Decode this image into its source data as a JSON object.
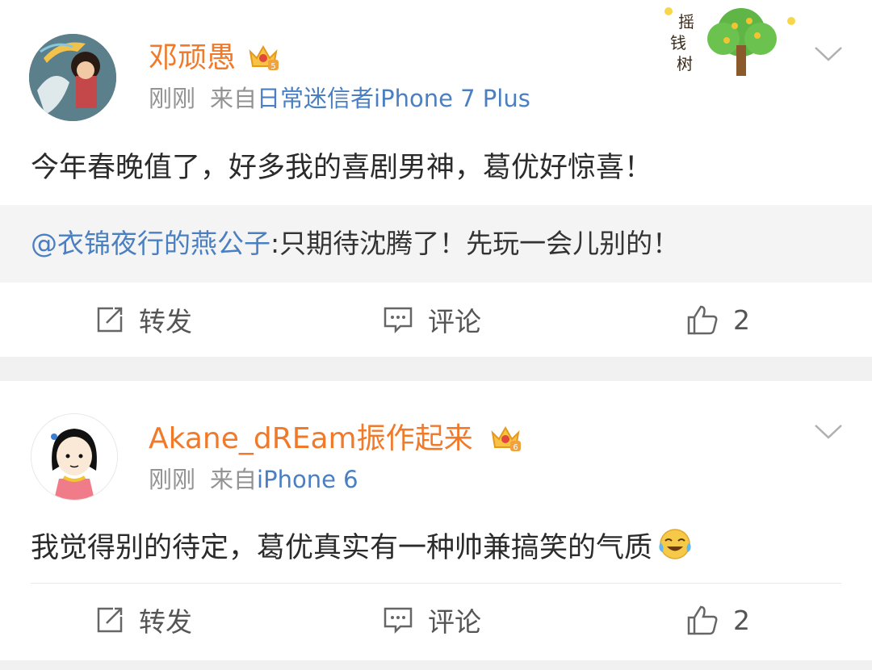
{
  "posts": [
    {
      "username": "邓顽愚",
      "vip_level": "5",
      "time": "刚刚",
      "source_prefix": "来自",
      "source": "日常迷信者iPhone 7 Plus",
      "content": "今年春晚值了，好多我的喜剧男神，葛优好惊喜！",
      "reply_mention": "@衣锦夜行的燕公子",
      "reply_text": ":只期待沈腾了！先玩一会儿别的！",
      "sticker_text": "摇钱树",
      "actions": {
        "repost": "转发",
        "comment": "评论",
        "like": "2"
      }
    },
    {
      "username": "Akane_dREam振作起来",
      "vip_level": "6",
      "time": "刚刚",
      "source_prefix": "来自",
      "source": "iPhone 6",
      "content": "我觉得别的待定，葛优真实有一种帅兼搞笑的气质",
      "actions": {
        "repost": "转发",
        "comment": "评论",
        "like": "2"
      }
    }
  ],
  "colors": {
    "username": "#f07a2a",
    "link": "#4a7fc1",
    "meta": "#939393",
    "background": "#f1f1f2"
  },
  "icons": [
    "vip-crown-icon",
    "chevron-down-icon",
    "repost-icon",
    "comment-icon",
    "like-icon",
    "laugh-cry-emoji-icon",
    "money-tree-sticker"
  ]
}
